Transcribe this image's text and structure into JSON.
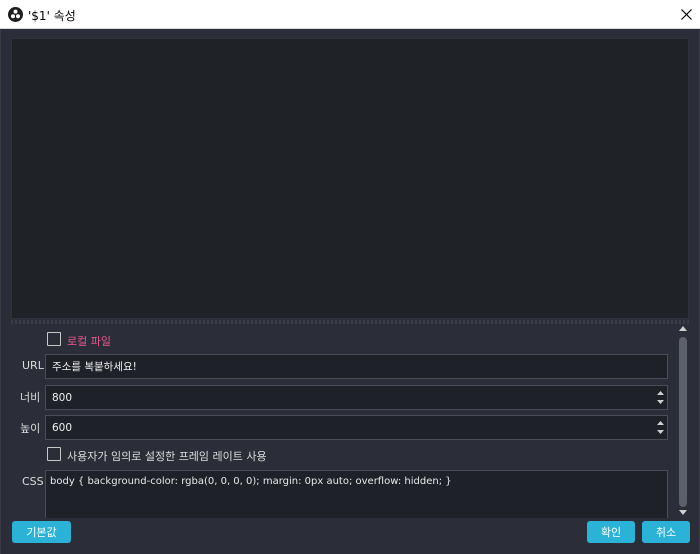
{
  "window": {
    "title": "'$1' 속성",
    "app_icon": "obs-icon",
    "close_icon": "close-icon"
  },
  "form": {
    "local_file_label": "로컬 파일",
    "local_file_checked": false,
    "url_label": "URL",
    "url_value": "주소를 복붙하세요!",
    "width_label": "너비",
    "width_value": "800",
    "height_label": "높이",
    "height_value": "600",
    "custom_fps_label": "사용자가 임의로 설정한 프레임 레이트 사용",
    "custom_fps_checked": false,
    "css_label": "CSS",
    "css_value": "body { background-color: rgba(0, 0, 0, 0); margin: 0px auto; overflow: hidden; }"
  },
  "buttons": {
    "defaults": "기본값",
    "ok": "확인",
    "cancel": "취소"
  },
  "colors": {
    "background": "#2b2e38",
    "accent": "#2ab3d6",
    "local_file_label": "#e8568a"
  }
}
